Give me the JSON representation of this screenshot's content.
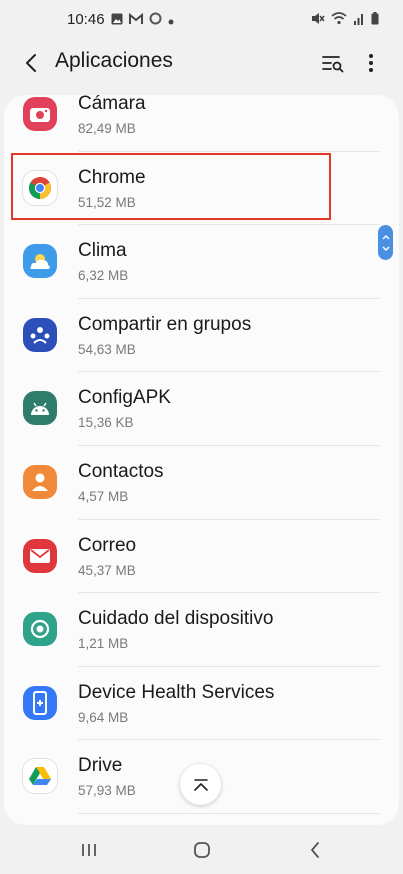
{
  "status_bar": {
    "time": "10:46",
    "left_icons": [
      "gallery-icon",
      "gmail-icon",
      "circle-notification-icon",
      "dot-icon"
    ],
    "right_icons": [
      "mute-icon",
      "wifi-icon",
      "signal-icon",
      "battery-icon"
    ]
  },
  "header": {
    "title": "Aplicaciones",
    "back_icon": "back-arrow-icon",
    "filter_icon": "filter-search-icon",
    "more_icon": "more-vert-icon"
  },
  "apps": [
    {
      "name": "Cámara",
      "size": "82,49 MB",
      "icon": "camera-icon",
      "color": "#e0405a"
    },
    {
      "name": "Chrome",
      "size": "51,52 MB",
      "icon": "chrome-icon",
      "color": "#ffffff",
      "highlighted": true
    },
    {
      "name": "Clima",
      "size": "6,32 MB",
      "icon": "weather-icon",
      "color": "#3d9be9"
    },
    {
      "name": "Compartir en grupos",
      "size": "54,63 MB",
      "icon": "group-share-icon",
      "color": "#2b4fb8"
    },
    {
      "name": "ConfigAPK",
      "size": "15,36 KB",
      "icon": "android-icon",
      "color": "#2e7d6a"
    },
    {
      "name": "Contactos",
      "size": "4,57 MB",
      "icon": "contacts-icon",
      "color": "#f08a3a"
    },
    {
      "name": "Correo",
      "size": "45,37 MB",
      "icon": "mail-icon",
      "color": "#e0373c"
    },
    {
      "name": "Cuidado del dispositivo",
      "size": "1,21 MB",
      "icon": "device-care-icon",
      "color": "#2fa38a"
    },
    {
      "name": "Device Health Services",
      "size": "9,64 MB",
      "icon": "device-health-icon",
      "color": "#3478f6"
    },
    {
      "name": "Drive",
      "size": "57,93 MB",
      "icon": "drive-icon",
      "color": "#ffffff"
    }
  ],
  "colors": {
    "highlight_border": "#e2392b",
    "scroll_handle": "#4a90e2",
    "background": "#f1f1f1",
    "card": "#fbfbfb"
  },
  "nav_bar": {
    "buttons": [
      "recents-icon",
      "home-icon",
      "back-icon"
    ]
  }
}
